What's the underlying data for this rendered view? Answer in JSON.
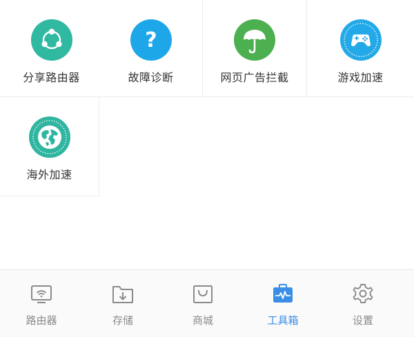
{
  "colors": {
    "share_icon": "#2bb39b",
    "diagnose_icon": "#1ea7e8",
    "adblock_icon": "#4caf50",
    "game_icon": "#23a9e8",
    "overseas_icon": "#2fb5a0",
    "tab_inactive": "#8a8a8a",
    "tab_active": "#3a8ee6"
  },
  "tools": [
    {
      "label": "分享路由器",
      "icon": "share-icon"
    },
    {
      "label": "故障诊断",
      "icon": "question-icon"
    },
    {
      "label": "网页广告拦截",
      "icon": "umbrella-icon"
    },
    {
      "label": "游戏加速",
      "icon": "gamepad-icon"
    },
    {
      "label": "海外加速",
      "icon": "globe-icon"
    }
  ],
  "tabs": [
    {
      "label": "路由器",
      "icon": "router-icon",
      "active": false
    },
    {
      "label": "存储",
      "icon": "storage-icon",
      "active": false
    },
    {
      "label": "商城",
      "icon": "shop-icon",
      "active": false
    },
    {
      "label": "工具箱",
      "icon": "toolbox-icon",
      "active": true
    },
    {
      "label": "设置",
      "icon": "gear-icon",
      "active": false
    }
  ]
}
